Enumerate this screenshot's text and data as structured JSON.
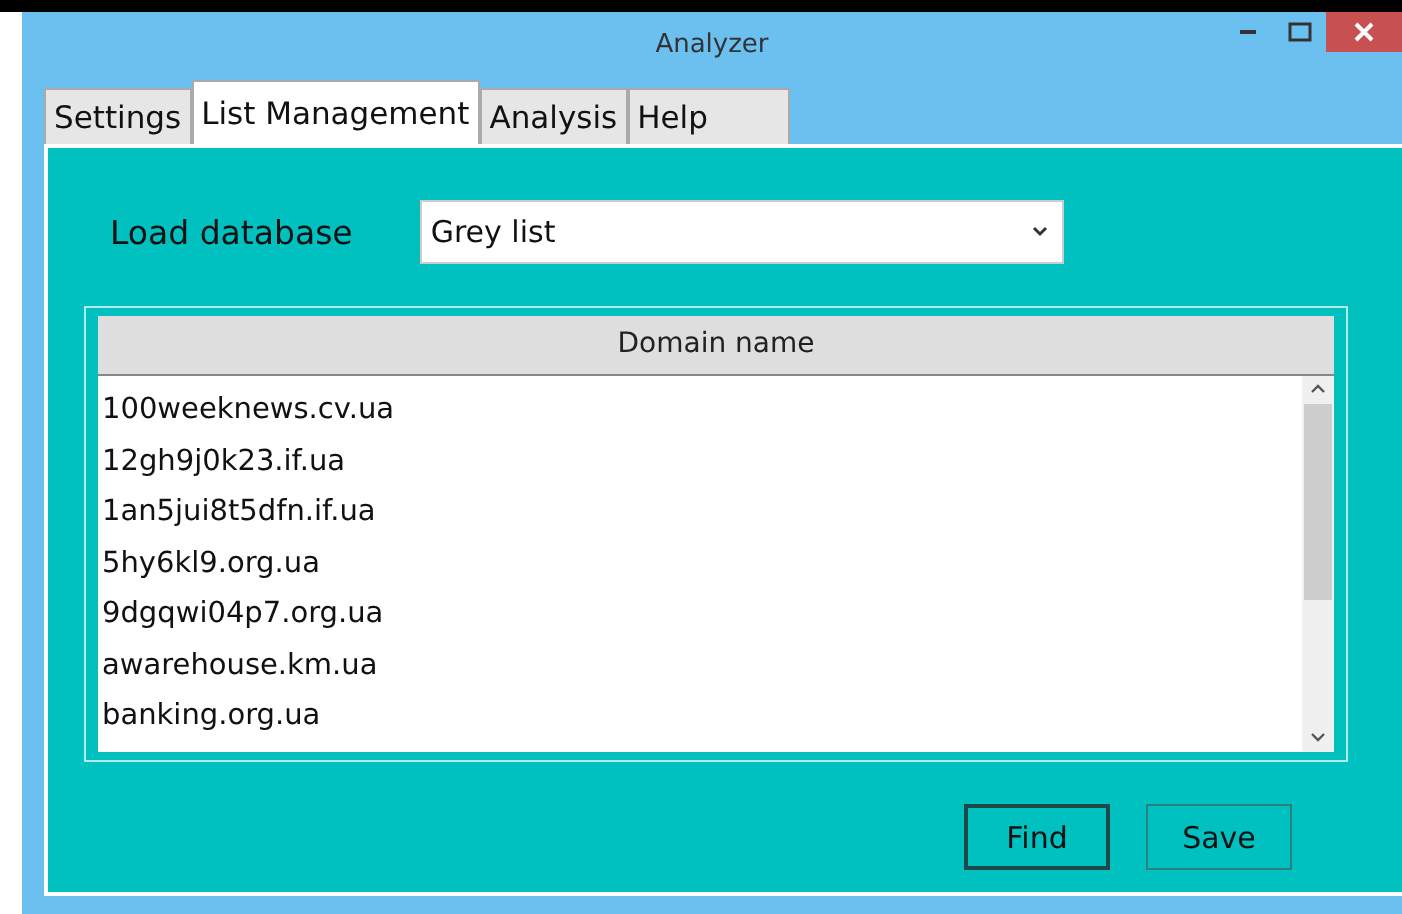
{
  "window": {
    "title": "Analyzer"
  },
  "tabs": [
    {
      "label": "Settings",
      "selected": false
    },
    {
      "label": "List Management",
      "selected": true
    },
    {
      "label": "Analysis",
      "selected": false
    },
    {
      "label": "Help",
      "selected": false
    }
  ],
  "load_database": {
    "label": "Load database",
    "value": "Grey list"
  },
  "table": {
    "columns": [
      "Domain name"
    ],
    "rows": [
      "100weeknews.cv.ua",
      "12gh9j0k23.if.ua",
      "1an5jui8t5dfn.if.ua",
      "5hy6kl9.org.ua",
      "9dgqwi04p7.org.ua",
      "awarehouse.km.ua",
      "banking.org.ua"
    ]
  },
  "buttons": [
    {
      "label": "Find",
      "default": true
    },
    {
      "label": "Save",
      "default": false
    }
  ]
}
